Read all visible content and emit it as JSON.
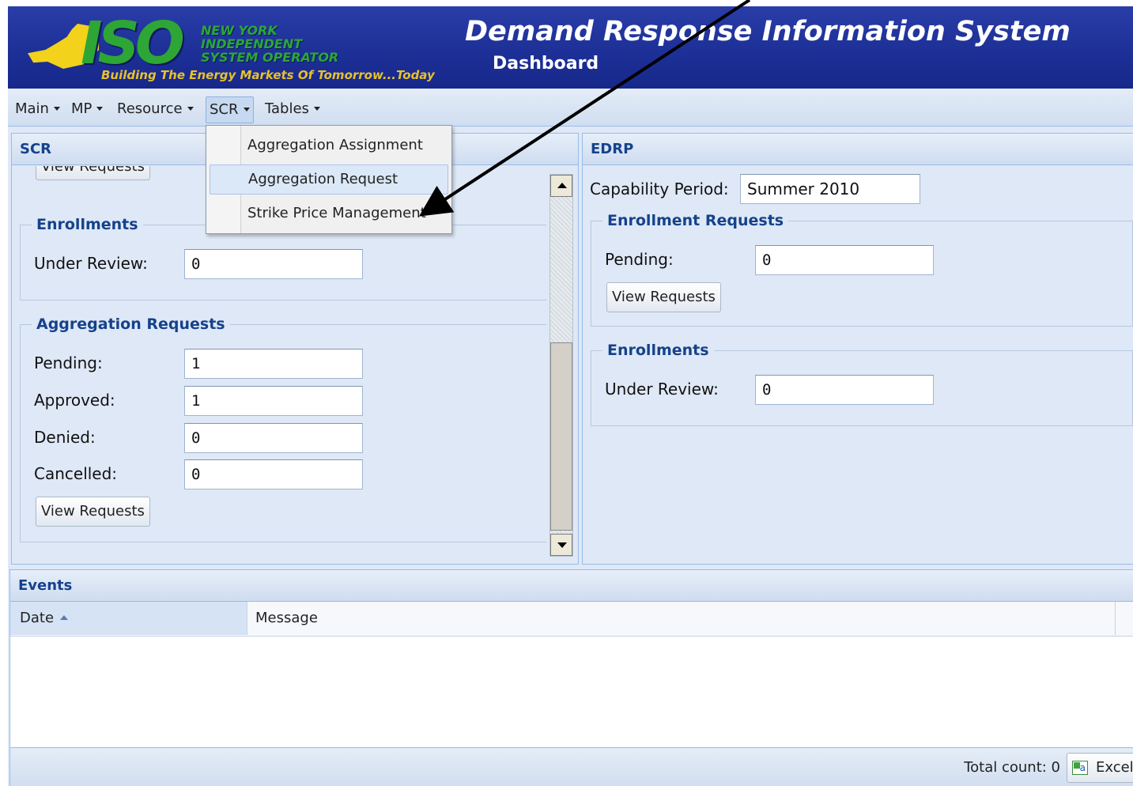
{
  "header": {
    "logo_mark": "ISO",
    "logo_org_lines": [
      "NEW YORK",
      "INDEPENDENT",
      "SYSTEM OPERATOR"
    ],
    "logo_tagline": "Building The Energy Markets Of Tomorrow...Today",
    "title": "Demand Response Information System",
    "subtitle": "Dashboard"
  },
  "menubar": {
    "items": [
      {
        "label": "Main"
      },
      {
        "label": "MP"
      },
      {
        "label": "Resource"
      },
      {
        "label": "SCR",
        "active": true
      },
      {
        "label": "Tables"
      }
    ]
  },
  "dropdown": {
    "items": [
      {
        "label": "Aggregation Assignment"
      },
      {
        "label": "Aggregation Request",
        "hovered": true
      },
      {
        "label": "Strike Price Management"
      }
    ]
  },
  "scr_panel": {
    "title": "SCR",
    "top_button_label": "View Requests",
    "enrollments": {
      "legend": "Enrollments",
      "under_review_label": "Under Review:",
      "under_review_value": "0"
    },
    "aggregation_requests": {
      "legend": "Aggregation Requests",
      "pending_label": "Pending:",
      "pending_value": "1",
      "approved_label": "Approved:",
      "approved_value": "1",
      "denied_label": "Denied:",
      "denied_value": "0",
      "cancelled_label": "Cancelled:",
      "cancelled_value": "0",
      "view_button_label": "View Requests"
    }
  },
  "edrp_panel": {
    "title": "EDRP",
    "capability_label": "Capability Period:",
    "capability_value": "Summer 2010",
    "enrollment_requests": {
      "legend": "Enrollment Requests",
      "pending_label": "Pending:",
      "pending_value": "0",
      "view_button_label": "View Requests"
    },
    "enrollments": {
      "legend": "Enrollments",
      "under_review_label": "Under Review:",
      "under_review_value": "0"
    }
  },
  "events_panel": {
    "title": "Events",
    "columns": [
      "Date",
      "Message"
    ],
    "rows": [],
    "total_count_text": "Total count: 0",
    "export_label": "Excel"
  },
  "colors": {
    "header_blue": "#1c2f96",
    "logo_green": "#2da636",
    "panel_title": "#15428b",
    "panel_bg": "#dfe8f6"
  }
}
